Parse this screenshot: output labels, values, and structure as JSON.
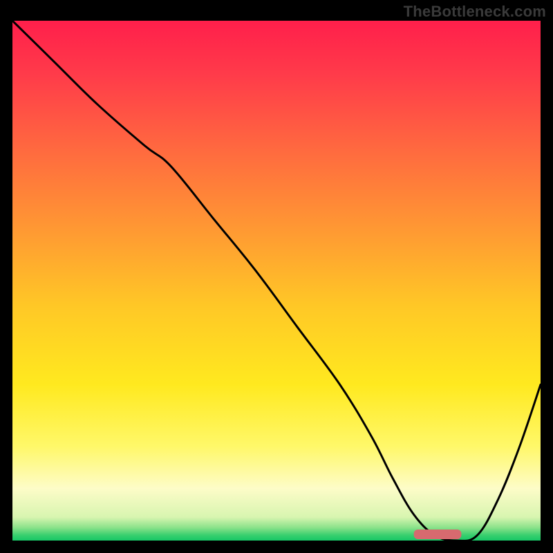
{
  "watermark": "TheBottleneck.com",
  "chart_data": {
    "type": "line",
    "title": "",
    "xlabel": "",
    "ylabel": "",
    "xlim": [
      0,
      100
    ],
    "ylim": [
      0,
      100
    ],
    "grid": false,
    "gradient_stops": [
      {
        "offset": 0.0,
        "color": "#ff1f4b"
      },
      {
        "offset": 0.1,
        "color": "#ff3a4a"
      },
      {
        "offset": 0.25,
        "color": "#ff6a3f"
      },
      {
        "offset": 0.4,
        "color": "#ff9833"
      },
      {
        "offset": 0.55,
        "color": "#ffc826"
      },
      {
        "offset": 0.7,
        "color": "#ffe91f"
      },
      {
        "offset": 0.82,
        "color": "#fff86a"
      },
      {
        "offset": 0.9,
        "color": "#fdfcc8"
      },
      {
        "offset": 0.955,
        "color": "#d8f5b0"
      },
      {
        "offset": 0.975,
        "color": "#8be28a"
      },
      {
        "offset": 0.99,
        "color": "#37cf6e"
      },
      {
        "offset": 1.0,
        "color": "#18c867"
      }
    ],
    "series": [
      {
        "name": "bottleneck-curve",
        "x": [
          0,
          8,
          16,
          25,
          30,
          38,
          46,
          54,
          62,
          68,
          72,
          76,
          80,
          84,
          88,
          92,
          96,
          100
        ],
        "y": [
          100,
          92,
          84,
          76,
          72,
          62,
          52,
          41,
          30,
          20,
          12,
          5,
          1,
          0,
          1,
          8,
          18,
          30
        ]
      }
    ],
    "marker": {
      "name": "optimum-range",
      "x_start": 76,
      "x_end": 85,
      "y": 1.2,
      "color": "#d76a6f"
    }
  }
}
